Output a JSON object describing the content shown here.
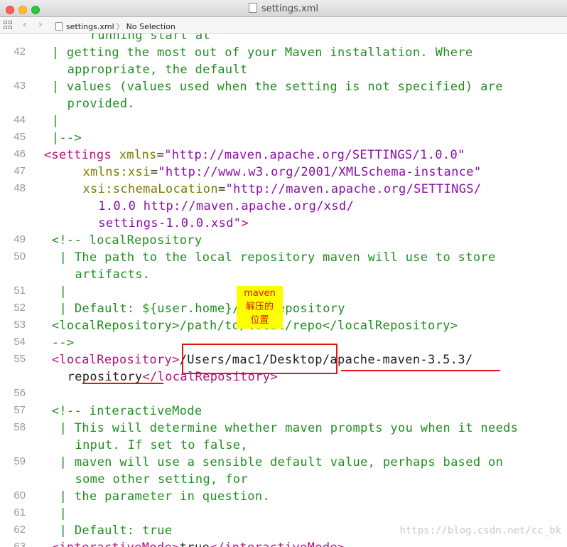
{
  "window": {
    "title": "settings.xml"
  },
  "jumpbar": {
    "file": "settings.xml",
    "selection": "No Selection"
  },
  "lines": [
    {
      "n": "",
      "i": 6,
      "h": "<span class=\"c\">  running start at</span>"
    },
    {
      "n": "42",
      "i": 3,
      "h": "<span class=\"c\">| getting the most out of your Maven installation. Where</span>"
    },
    {
      "n": "",
      "i": 5,
      "h": "<span class=\"c\">appropriate, the default</span>"
    },
    {
      "n": "43",
      "i": 3,
      "h": "<span class=\"c\">| values (values used when the setting is not specified) are</span>"
    },
    {
      "n": "",
      "i": 5,
      "h": "<span class=\"c\">provided.</span>"
    },
    {
      "n": "44",
      "i": 3,
      "h": "<span class=\"c\">|</span>"
    },
    {
      "n": "45",
      "i": 3,
      "h": "<span class=\"c\">|--></span>"
    },
    {
      "n": "46",
      "i": 2,
      "h": "<span class=\"t\">&lt;settings</span> <span class=\"a\">xmlns</span><span class=\"k\">=</span><span class=\"s\">\"http://maven.apache.org/SETTINGS/1.0.0\"</span>"
    },
    {
      "n": "47",
      "i": 7,
      "h": "<span class=\"a\">xmlns:xsi</span><span class=\"k\">=</span><span class=\"s\">\"http://www.w3.org/2001/XMLSchema-instance\"</span>"
    },
    {
      "n": "48",
      "i": 7,
      "h": "<span class=\"a\">xsi:schemaLocation</span><span class=\"k\">=</span><span class=\"s\">\"http://maven.apache.org/SETTINGS/</span>"
    },
    {
      "n": "",
      "i": 9,
      "h": "<span class=\"s\">1.0.0 http://maven.apache.org/xsd/</span>"
    },
    {
      "n": "",
      "i": 9,
      "h": "<span class=\"s\">settings-1.0.0.xsd\"</span><span class=\"t\">&gt;</span>"
    },
    {
      "n": "49",
      "i": 3,
      "h": "<span class=\"c\">&lt;!-- localRepository</span>"
    },
    {
      "n": "50",
      "i": 4,
      "h": "<span class=\"c\">| The path to the local repository maven will use to store</span>"
    },
    {
      "n": "",
      "i": 6,
      "h": "<span class=\"c\">artifacts.</span>"
    },
    {
      "n": "51",
      "i": 4,
      "h": "<span class=\"c\">|</span>"
    },
    {
      "n": "52",
      "i": 4,
      "h": "<span class=\"c\">| Default: ${user.home}/.m2/repository</span>"
    },
    {
      "n": "53",
      "i": 3,
      "h": "<span class=\"c\">&lt;localRepository&gt;/path/to/local/repo&lt;/localRepository&gt;</span>"
    },
    {
      "n": "54",
      "i": 3,
      "h": "<span class=\"c\">--></span>"
    },
    {
      "n": "55",
      "i": 3,
      "h": "<span class=\"t\">&lt;localRepository&gt;</span><span class=\"k\">/Users/mac1/Desktop/apache-maven-3.5.3/</span>"
    },
    {
      "n": "",
      "i": 5,
      "h": "<span class=\"k\">repository</span><span class=\"t\">&lt;/localRepository&gt;</span>"
    },
    {
      "n": "56",
      "i": 0,
      "h": ""
    },
    {
      "n": "57",
      "i": 3,
      "h": "<span class=\"c\">&lt;!-- interactiveMode</span>"
    },
    {
      "n": "58",
      "i": 4,
      "h": "<span class=\"c\">| This will determine whether maven prompts you when it needs</span>"
    },
    {
      "n": "",
      "i": 6,
      "h": "<span class=\"c\">input. If set to false,</span>"
    },
    {
      "n": "59",
      "i": 4,
      "h": "<span class=\"c\">| maven will use a sensible default value, perhaps based on</span>"
    },
    {
      "n": "",
      "i": 6,
      "h": "<span class=\"c\">some other setting, for</span>"
    },
    {
      "n": "60",
      "i": 4,
      "h": "<span class=\"c\">| the parameter in question.</span>"
    },
    {
      "n": "61",
      "i": 4,
      "h": "<span class=\"c\">|</span>"
    },
    {
      "n": "62",
      "i": 4,
      "h": "<span class=\"c\">| Default: true</span>"
    },
    {
      "n": "63",
      "i": 3,
      "h": "<span class=\"t\">&lt;interactiveMode&gt;</span><span class=\"k\">true</span><span class=\"t\">&lt;/interactiveMode&gt;</span>"
    }
  ],
  "annotation": {
    "line1": "maven",
    "line2": "解压的",
    "line3": "位置"
  },
  "watermark": "https://blog.csdn.net/cc_bk"
}
